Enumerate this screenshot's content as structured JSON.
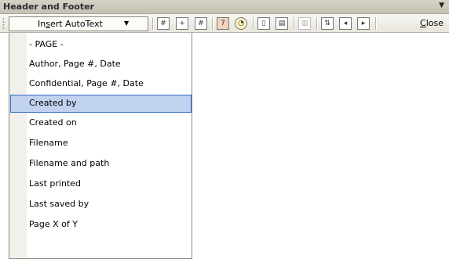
{
  "toolbar": {
    "title": "Header and Footer",
    "insert_autotext_label_pre": "In",
    "insert_autotext_label_underlined": "s",
    "insert_autotext_label_post": "ert AutoText",
    "close_underlined": "C",
    "close_rest": "lose",
    "icons": [
      "insert-page-number-icon",
      "insert-number-of-pages-icon",
      "format-page-number-icon",
      "insert-date-icon",
      "insert-time-icon",
      "page-setup-icon",
      "show-hide-document-text-icon",
      "same-as-previous-icon",
      "switch-header-footer-icon",
      "show-previous-icon",
      "show-next-icon"
    ]
  },
  "menu": {
    "items": [
      {
        "label": "- PAGE -"
      },
      {
        "label": "Author, Page #, Date"
      },
      {
        "label": "Confidential, Page #, Date"
      },
      {
        "label": "Created by",
        "selected": true
      },
      {
        "label": "Created on"
      },
      {
        "label": "Filename"
      },
      {
        "label": "Filename and path"
      },
      {
        "label": "Last printed"
      },
      {
        "label": "Last saved by"
      },
      {
        "label": "Page X of Y"
      }
    ]
  },
  "colors": {
    "selection_fill": "#c1d2ee",
    "selection_border": "#316ac5",
    "menu_gutter": "#f1f0ea"
  }
}
